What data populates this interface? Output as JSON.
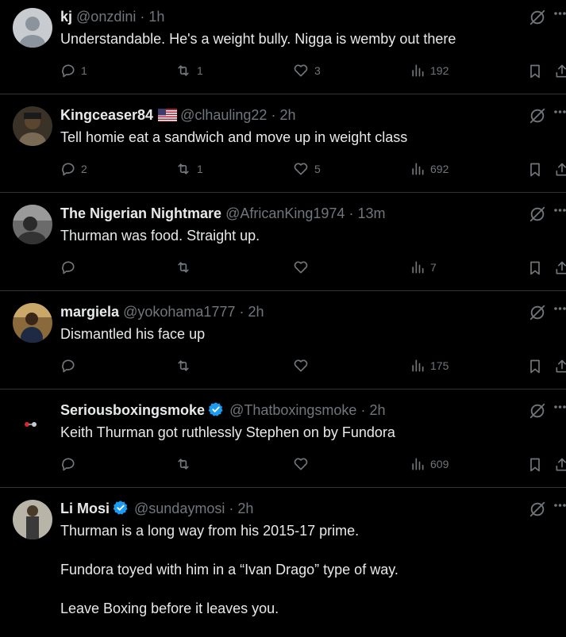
{
  "tweets": [
    {
      "name": "kj",
      "handle": "@onzdini",
      "time": "1h",
      "text": [
        "Understandable. He's a weight bully. Nigga is wemby out there"
      ],
      "replies": "1",
      "retweets": "1",
      "likes": "3",
      "views": "192"
    },
    {
      "name": "Kingceaser84",
      "flag": "us-flag",
      "handle": "@clhauling22",
      "time": "2h",
      "text": [
        "Tell homie eat a sandwich and move up in weight class"
      ],
      "replies": "2",
      "retweets": "1",
      "likes": "5",
      "views": "692"
    },
    {
      "name": "The Nigerian Nightmare",
      "handle": "@AfricanKing1974",
      "time": "13m",
      "text": [
        "Thurman was food. Straight up."
      ],
      "replies": "",
      "retweets": "",
      "likes": "",
      "views": "7"
    },
    {
      "name": "margiela",
      "handle": "@yokohama1777",
      "time": "2h",
      "text": [
        "Dismantled his face up"
      ],
      "replies": "",
      "retweets": "",
      "likes": "",
      "views": "175"
    },
    {
      "name": "Seriousboxingsmoke",
      "verified": true,
      "handle": "@Thatboxingsmoke",
      "time": "2h",
      "text": [
        "Keith Thurman got ruthlessly Stephen on by Fundora"
      ],
      "replies": "",
      "retweets": "",
      "likes": "",
      "views": "609"
    },
    {
      "name": "Li Mosi",
      "verified": true,
      "handle": "@sundaymosi",
      "time": "2h",
      "text": [
        "Thurman is a long way from his  2015-17 prime.",
        "Fundora toyed with him in a “Ivan Drago” type of way.",
        "Leave Boxing before it leaves you."
      ]
    }
  ],
  "separator": "·",
  "colors": {
    "background": "#000000",
    "text": "#e7e9ea",
    "muted": "#71767b",
    "verified": "#1d9bf0",
    "border": "#2f3336"
  }
}
